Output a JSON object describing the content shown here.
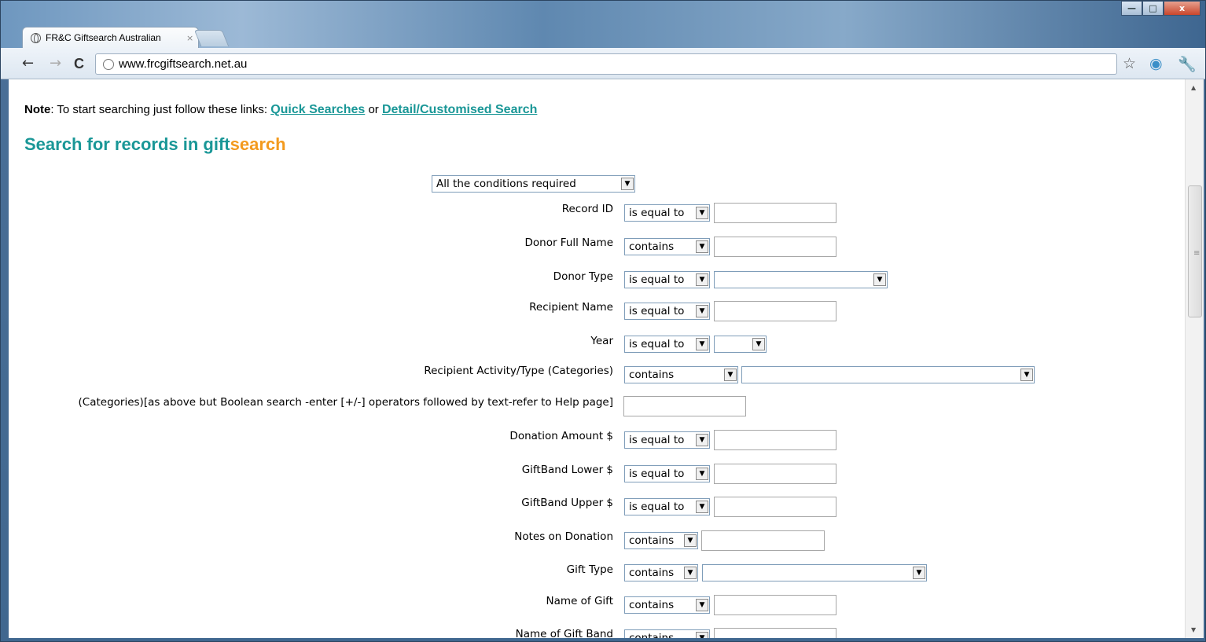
{
  "browser": {
    "tab_title": "FR&C Giftsearch Australian",
    "tab_close": "×",
    "url": "www.frcgiftsearch.net.au",
    "window_controls": {
      "minimize": "—",
      "maximize": "□",
      "close": "x"
    },
    "icons": [
      "back-icon",
      "forward-icon",
      "reload-icon",
      "globe-icon",
      "star-icon",
      "extension-icon",
      "wrench-icon"
    ]
  },
  "page": {
    "note_label": "Note",
    "note_text": ": To start searching just follow these links: ",
    "link_quick": "Quick Searches",
    "note_or": " or ",
    "link_detail": "Detail/Customised Search",
    "heading_part1": "Search for records in gift",
    "heading_part2": "search",
    "conditions_select": "All the conditions required",
    "fields": [
      {
        "label": "Record ID",
        "operator": "is equal to"
      },
      {
        "label": "Donor Full Name",
        "operator": "contains"
      },
      {
        "label": "Donor Type",
        "operator": "is equal to"
      },
      {
        "label": "Recipient Name",
        "operator": "is equal to"
      },
      {
        "label": "Year",
        "operator": "is equal to"
      },
      {
        "label": "Recipient Activity/Type (Categories)",
        "operator": "contains"
      },
      {
        "label": "(Categories)[as above but Boolean search -enter [+/-] operators followed by text-refer to Help page]",
        "operator": ""
      },
      {
        "label": "Donation Amount $",
        "operator": "is equal to"
      },
      {
        "label": "GiftBand Lower $",
        "operator": "is equal to"
      },
      {
        "label": "GiftBand Upper $",
        "operator": "is equal to"
      },
      {
        "label": "Notes on Donation",
        "operator": "contains"
      },
      {
        "label": "Gift Type",
        "operator": "contains"
      },
      {
        "label": "Name of Gift",
        "operator": "contains"
      },
      {
        "label": "Name of Gift Band",
        "operator": "contains"
      }
    ],
    "colors": {
      "teal": "#1a9797",
      "orange": "#f39a1e"
    }
  }
}
